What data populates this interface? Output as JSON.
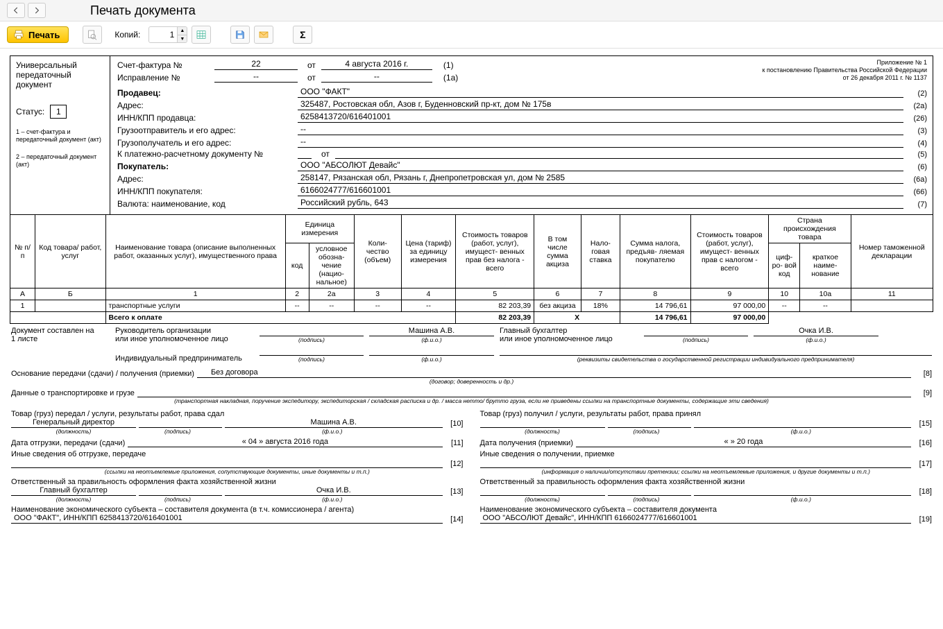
{
  "title": "Печать документа",
  "toolbar": {
    "print": "Печать",
    "copies_label": "Копий:",
    "copies_value": "1"
  },
  "appx": {
    "l1": "Приложение № 1",
    "l2": "к постановлению Правительства Российской Федерации",
    "l3": "от 26 декабря 2011 г. № 1137"
  },
  "left": {
    "h1": "Универсальный",
    "h2": "передаточный",
    "h3": "документ",
    "status_label": "Статус:",
    "status_value": "1",
    "legend1": "1 – счет-фактура и передаточный документ (акт)",
    "legend2": "2 – передаточный документ (акт)"
  },
  "hdr": {
    "sf_label": "Счет-фактура №",
    "sf_no": "22",
    "sf_from": "от",
    "sf_date": "4 августа 2016 г.",
    "sf_tail": "(1)",
    "fix_label": "Исправление №",
    "fix_no": "--",
    "fix_from": "от",
    "fix_date": "--",
    "fix_tail": "(1а)",
    "seller_lbl": "Продавец:",
    "seller_val": "ООО \"ФАКТ\"",
    "addr_lbl": "Адрес:",
    "addr_val": "325487, Ростовская обл, Азов г, Буденновский пр-кт, дом № 175в",
    "innkpp_lbl": "ИНН/КПП продавца:",
    "innkpp_val": "6258413720/616401001",
    "shipper_lbl": "Грузоотправитель и его адрес:",
    "shipper_val": "--",
    "consignee_lbl": "Грузополучатель и его адрес:",
    "consignee_val": "--",
    "paydoc_lbl": "К платежно-расчетному документу №",
    "paydoc_val": "",
    "paydoc_from": "от",
    "buyer_lbl": "Покупатель:",
    "buyer_val": "ООО \"АБСОЛЮТ Девайс\"",
    "baddr_lbl": "Адрес:",
    "baddr_val": "258147, Рязанская обл, Рязань г, Днепропетровская ул, дом № 2585",
    "binn_lbl": "ИНН/КПП покупателя:",
    "binn_val": "6166024777/616601001",
    "cur_lbl": "Валюта: наименование, код",
    "cur_val": "Российский рубль, 643",
    "tails": {
      "t2": "(2)",
      "t2a": "(2а)",
      "t26": "(26)",
      "t3": "(3)",
      "t4": "(4)",
      "t5": "(5)",
      "t6": "(6)",
      "t6a": "(6а)",
      "t66": "(66)",
      "t7": "(7)"
    }
  },
  "table": {
    "h_no": "№\nп/п",
    "h_code": "Код товара/\nработ, услуг",
    "h_name": "Наименование товара (описание выполненных работ, оказанных услуг), имущественного права",
    "h_unit_group": "Единица\nизмерения",
    "h_unit_code": "код",
    "h_unit_name": "условное обозна-\nчение (нацио-\nнальное)",
    "h_qty": "Коли-\nчество\n(объем)",
    "h_price": "Цена\n(тариф)\nза\nединицу\nизмерения",
    "h_sumnet": "Стоимость товаров (работ, услуг), имущест-\nвенных прав без налога - всего",
    "h_excise": "В том\nчисле\nсумма\nакциза",
    "h_rate": "Нало-\nговая\nставка",
    "h_tax": "Сумма\nналога,\nпредъяв-\nляемая\nпокупателю",
    "h_sumgross": "Стоимость товаров (работ, услуг), имущест-\nвенных прав с налогом - всего",
    "h_country_group": "Страна\nпроисхождения\nтовара",
    "h_country_code": "циф-\nро-\nвой\nкод",
    "h_country_name": "краткое\nнаиме-\nнование",
    "h_decl": "Номер\nтаможенной\nдекларации",
    "num_row": {
      "a": "А",
      "b": "Б",
      "c1": "1",
      "c2": "2",
      "c2a": "2а",
      "c3": "3",
      "c4": "4",
      "c5": "5",
      "c6": "6",
      "c7": "7",
      "c8": "8",
      "c9": "9",
      "c10": "10",
      "c10a": "10а",
      "c11": "11"
    },
    "rows": [
      {
        "n": "1",
        "code": "",
        "name": "транспортные услуги",
        "uc": "--",
        "un": "--",
        "qty": "--",
        "price": "--",
        "net": "82 203,39",
        "exc": "без акциза",
        "rate": "18%",
        "tax": "14 796,61",
        "gross": "97 000,00",
        "cc": "--",
        "cn": "--",
        "decl": ""
      }
    ],
    "total_label": "Всего к оплате",
    "total_net": "82 203,39",
    "total_exc": "X",
    "total_tax": "14 796,61",
    "total_gross": "97 000,00"
  },
  "foot": {
    "doc_on": "Документ составлен на",
    "doc_on2": "1 листе",
    "head_org": "Руководитель организации",
    "head_org2": "или иное уполномоченное лицо",
    "head_name": "Машина А.В.",
    "acc_org": "Главный бухгалтер",
    "acc_org2": "или иное уполномоченное лицо",
    "acc_name": "Очка И.В.",
    "ip": "Индивидуальный предприниматель",
    "cap_sign": "(подпись)",
    "cap_fio": "(ф.и.о.)",
    "cap_ip": "(реквизиты свидетельства о государственной  регистрации индивидуального предпринимателя)",
    "basis_lbl": "Основание передачи (сдачи) / получения (приемки)",
    "basis_val": "Без договора",
    "basis_cap": "(договор; доверенность и др.)",
    "trans_lbl": "Данные о транспортировке и грузе",
    "trans_cap": "(транспортная накладная, поручение экспедитору, экспедиторская / складская расписка и др. / масса нетто/ брутто груза, если не приведены ссылки на транспортные документы, содержащие эти сведения)",
    "left": {
      "gave": "Товар (груз) передал / услуги, результаты работ, права сдал",
      "pos": "Генеральный директор",
      "name": "Машина А.В.",
      "pos_cap": "(должность)",
      "date_lbl": "Дата отгрузки, передачи (сдачи)",
      "date_val": "« 04 »    августа   2016   года",
      "other_lbl": "Иные сведения об отгрузке, передаче",
      "other_cap": "(ссылки на неотъемлемые приложения, сопутствующие документы, иные документы и т.п.)",
      "resp_lbl": "Ответственный за правильность оформления факта хозяйственной жизни",
      "resp_pos": "Главный бухгалтер",
      "resp_name": "Очка И.В.",
      "econ_lbl": "Наименование экономического субъекта – составителя документа (в т.ч. комиссионера / агента)",
      "econ_val": "ООО \"ФАКТ\", ИНН/КПП 6258413720/616401001"
    },
    "right": {
      "got": "Товар (груз) получил / услуги, результаты работ, права принял",
      "pos_cap": "(должность)",
      "date_lbl": "Дата получения (приемки)",
      "date_val": "«        »                         20       года",
      "other_lbl": "Иные сведения о получении, приемке",
      "other_cap": "(информация о наличии/отсутствии претензии; ссылки на неотъемлемые приложения, и другие  документы и т.п.)",
      "resp_lbl": "Ответственный за правильность оформления факта хозяйственной жизни",
      "econ_lbl": "Наименование экономического субъекта – составителя документа",
      "econ_val": "ООО \"АБСОЛЮТ Девайс\", ИНН/КПП 6166024777/616601001"
    },
    "nums": {
      "n8": "[8]",
      "n9": "[9]",
      "n10": "[10]",
      "n11": "[11]",
      "n12": "[12]",
      "n13": "[13]",
      "n14": "[14]",
      "n15": "[15]",
      "n16": "[16]",
      "n17": "[17]",
      "n18": "[18]",
      "n19": "[19]"
    }
  }
}
